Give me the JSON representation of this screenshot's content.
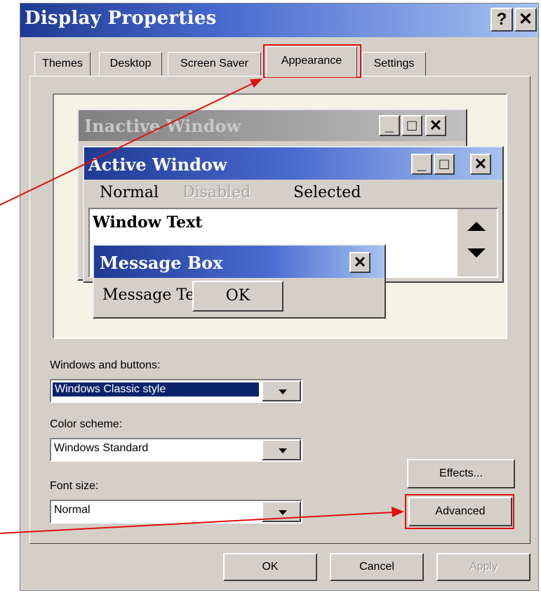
{
  "window": {
    "title": "Display Properties",
    "help_label": "?",
    "close_label": "✕"
  },
  "tabs": [
    {
      "label": "Themes",
      "active": false
    },
    {
      "label": "Desktop",
      "active": false
    },
    {
      "label": "Screen Saver",
      "active": false
    },
    {
      "label": "Appearance",
      "active": true
    },
    {
      "label": "Settings",
      "active": false
    }
  ],
  "preview": {
    "inactive_title": "Inactive Window",
    "active_title": "Active Window",
    "menu_normal": "Normal",
    "menu_disabled": "Disabled",
    "menu_selected": "Selected",
    "window_text": "Window Text",
    "msgbox_title": "Message Box",
    "msgbox_text": "Message Text",
    "msgbox_ok": "OK",
    "min_glyph": "_",
    "max_glyph": "□",
    "close_glyph": "✕"
  },
  "controls": {
    "windows_buttons_label": "Windows and buttons:",
    "windows_buttons_value": "Windows Classic style",
    "color_scheme_label": "Color scheme:",
    "color_scheme_value": "Windows Standard",
    "font_size_label": "Font size:",
    "font_size_value": "Normal",
    "effects_label": "Effects...",
    "advanced_label": "Advanced"
  },
  "footer": {
    "ok_label": "OK",
    "cancel_label": "Cancel",
    "apply_label": "Apply"
  },
  "colors": {
    "title_gradient_start": "#1f3a93",
    "selection": "#0a246a",
    "annotation": "#e01010"
  }
}
